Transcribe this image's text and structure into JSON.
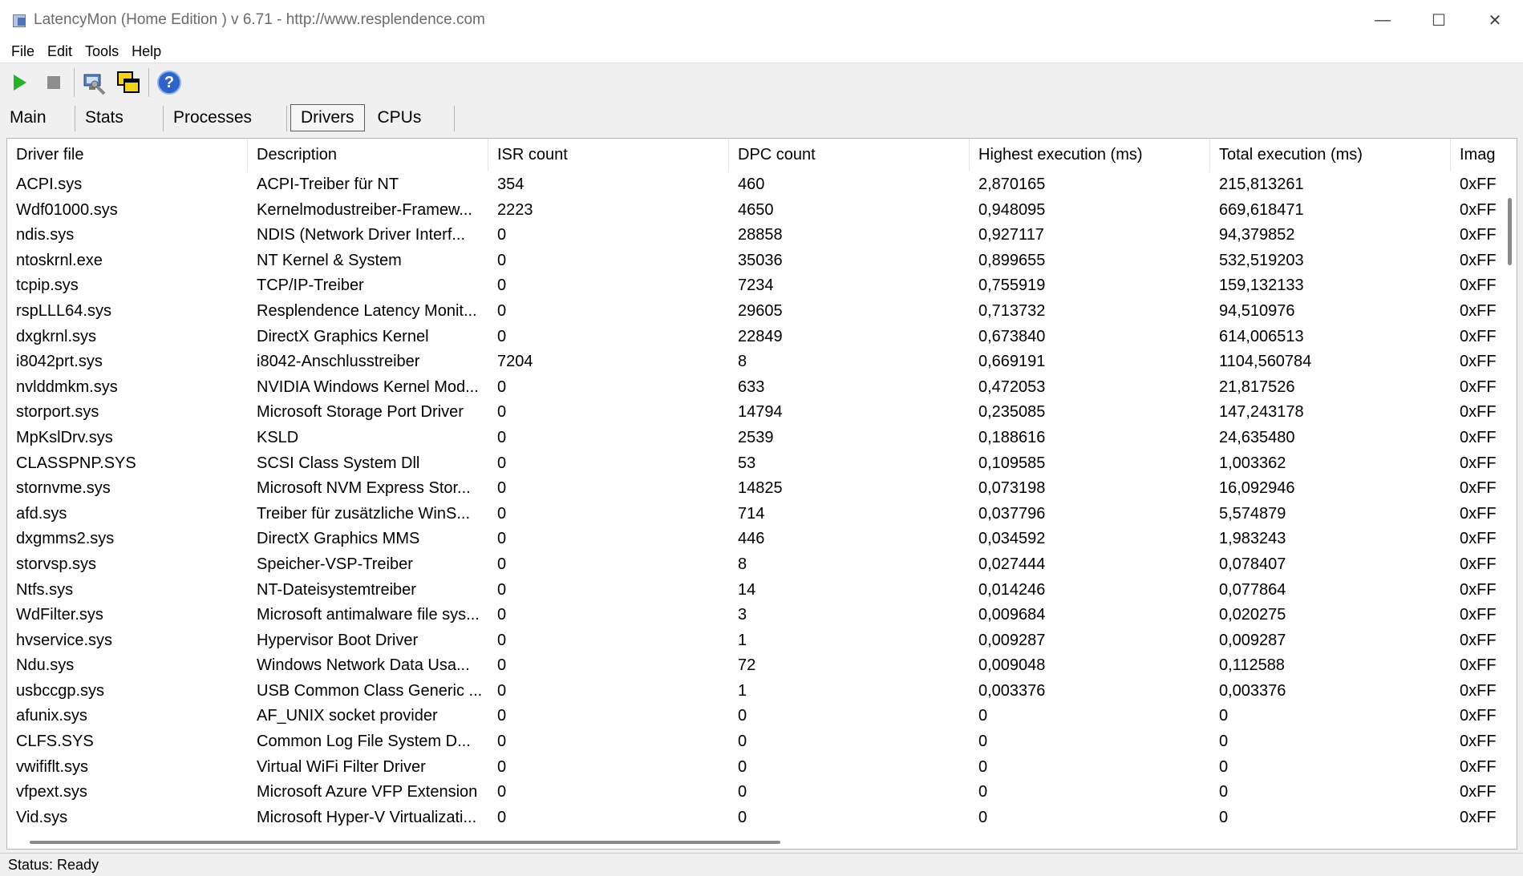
{
  "window": {
    "title": "LatencyMon  (Home Edition )  v 6.71 - http://www.resplendence.com",
    "controls": {
      "minimize": "—",
      "maximize": "☐",
      "close": "✕"
    }
  },
  "menu": [
    "File",
    "Edit",
    "Tools",
    "Help"
  ],
  "toolbar": {
    "buttons": [
      "play-icon",
      "stop-icon",
      "computer-wrench-icon",
      "copy-windows-icon",
      "help-icon"
    ],
    "help_glyph": "?"
  },
  "tabs": [
    "Main",
    "Stats",
    "Processes",
    "Drivers",
    "CPUs"
  ],
  "active_tab": "Drivers",
  "table": {
    "columns": [
      "Driver file",
      "Description",
      "ISR count",
      "DPC count",
      "Highest execution (ms)",
      "Total execution (ms)",
      "Imag"
    ],
    "rows": [
      [
        "ACPI.sys",
        "ACPI-Treiber für NT",
        "354",
        "460",
        "2,870165",
        "215,813261",
        "0xFF"
      ],
      [
        "Wdf01000.sys",
        "Kernelmodustreiber-Framew...",
        "2223",
        "4650",
        "0,948095",
        "669,618471",
        "0xFF"
      ],
      [
        "ndis.sys",
        "NDIS (Network Driver Interf...",
        "0",
        "28858",
        "0,927117",
        "94,379852",
        "0xFF"
      ],
      [
        "ntoskrnl.exe",
        "NT Kernel & System",
        "0",
        "35036",
        "0,899655",
        "532,519203",
        "0xFF"
      ],
      [
        "tcpip.sys",
        "TCP/IP-Treiber",
        "0",
        "7234",
        "0,755919",
        "159,132133",
        "0xFF"
      ],
      [
        "rspLLL64.sys",
        "Resplendence Latency Monit...",
        "0",
        "29605",
        "0,713732",
        "94,510976",
        "0xFF"
      ],
      [
        "dxgkrnl.sys",
        "DirectX Graphics Kernel",
        "0",
        "22849",
        "0,673840",
        "614,006513",
        "0xFF"
      ],
      [
        "i8042prt.sys",
        "i8042-Anschlusstreiber",
        "7204",
        "8",
        "0,669191",
        "1104,560784",
        "0xFF"
      ],
      [
        "nvlddmkm.sys",
        "NVIDIA Windows Kernel Mod...",
        "0",
        "633",
        "0,472053",
        "21,817526",
        "0xFF"
      ],
      [
        "storport.sys",
        "Microsoft Storage Port Driver",
        "0",
        "14794",
        "0,235085",
        "147,243178",
        "0xFF"
      ],
      [
        "MpKslDrv.sys",
        "KSLD",
        "0",
        "2539",
        "0,188616",
        "24,635480",
        "0xFF"
      ],
      [
        "CLASSPNP.SYS",
        "SCSI Class System Dll",
        "0",
        "53",
        "0,109585",
        "1,003362",
        "0xFF"
      ],
      [
        "stornvme.sys",
        "Microsoft NVM Express Stor...",
        "0",
        "14825",
        "0,073198",
        "16,092946",
        "0xFF"
      ],
      [
        "afd.sys",
        "Treiber für zusätzliche WinS...",
        "0",
        "714",
        "0,037796",
        "5,574879",
        "0xFF"
      ],
      [
        "dxgmms2.sys",
        "DirectX Graphics MMS",
        "0",
        "446",
        "0,034592",
        "1,983243",
        "0xFF"
      ],
      [
        "storvsp.sys",
        "Speicher-VSP-Treiber",
        "0",
        "8",
        "0,027444",
        "0,078407",
        "0xFF"
      ],
      [
        "Ntfs.sys",
        "NT-Dateisystemtreiber",
        "0",
        "14",
        "0,014246",
        "0,077864",
        "0xFF"
      ],
      [
        "WdFilter.sys",
        "Microsoft antimalware file sys...",
        "0",
        "3",
        "0,009684",
        "0,020275",
        "0xFF"
      ],
      [
        "hvservice.sys",
        "Hypervisor Boot Driver",
        "0",
        "1",
        "0,009287",
        "0,009287",
        "0xFF"
      ],
      [
        "Ndu.sys",
        "Windows Network Data Usa...",
        "0",
        "72",
        "0,009048",
        "0,112588",
        "0xFF"
      ],
      [
        "usbccgp.sys",
        "USB Common Class Generic ...",
        "0",
        "1",
        "0,003376",
        "0,003376",
        "0xFF"
      ],
      [
        "afunix.sys",
        "AF_UNIX socket provider",
        "0",
        "0",
        "0",
        "0",
        "0xFF"
      ],
      [
        "CLFS.SYS",
        "Common Log File System D...",
        "0",
        "0",
        "0",
        "0",
        "0xFF"
      ],
      [
        "vwififlt.sys",
        "Virtual WiFi Filter Driver",
        "0",
        "0",
        "0",
        "0",
        "0xFF"
      ],
      [
        "vfpext.sys",
        "Microsoft Azure VFP Extension",
        "0",
        "0",
        "0",
        "0",
        "0xFF"
      ],
      [
        "Vid.sys",
        "Microsoft Hyper-V Virtualizati...",
        "0",
        "0",
        "0",
        "0",
        "0xFF"
      ]
    ]
  },
  "status": "Status: Ready"
}
